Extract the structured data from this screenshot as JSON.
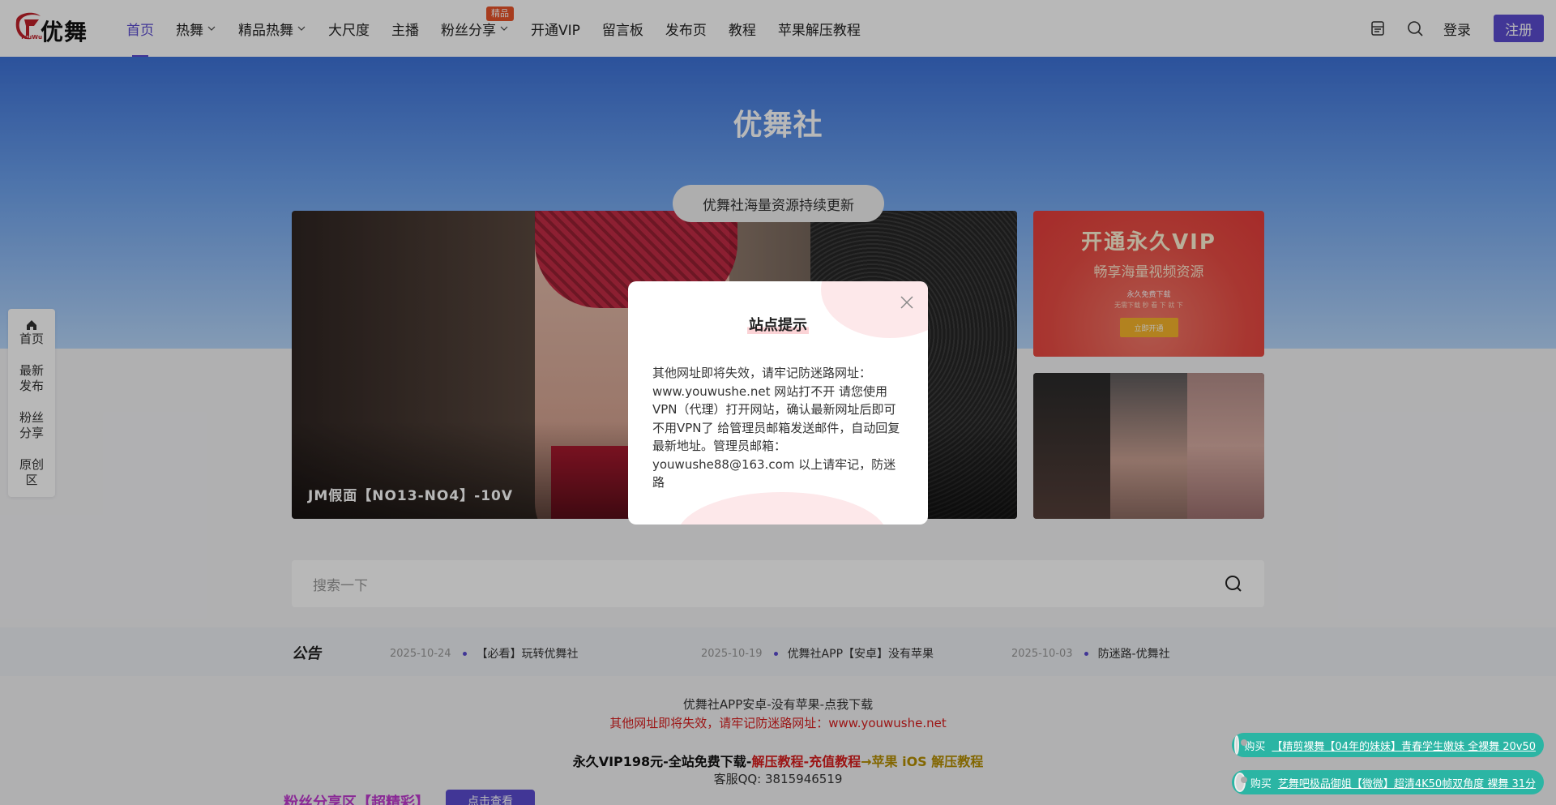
{
  "header": {
    "logo_text": "优舞",
    "logo_sub": "YouWu",
    "nav": [
      {
        "label": "首页",
        "active": true,
        "dropdown": false
      },
      {
        "label": "热舞",
        "dropdown": true
      },
      {
        "label": "精品热舞",
        "dropdown": true
      },
      {
        "label": "大尺度",
        "dropdown": false
      },
      {
        "label": "主播",
        "dropdown": false
      },
      {
        "label": "粉丝分享",
        "dropdown": true,
        "badge": "精品"
      },
      {
        "label": "开通VIP",
        "dropdown": false
      },
      {
        "label": "留言板",
        "dropdown": false
      },
      {
        "label": "发布页",
        "dropdown": false
      },
      {
        "label": "教程",
        "dropdown": false
      },
      {
        "label": "苹果解压教程",
        "dropdown": false
      }
    ],
    "login_label": "登录",
    "register_label": "注册",
    "icons": [
      "notebook-icon",
      "search-icon"
    ]
  },
  "hero": {
    "title": "优舞社",
    "pill": "优舞社海量资源持续更新"
  },
  "slider": {
    "caption": "JM假面【NO13-NO4】-10V"
  },
  "vip_card": {
    "title": "开通永久VIP",
    "subtitle": "畅享海量视频资源",
    "small1": "永久免费下载",
    "small2": "无需下载 秒 看 下 就 下",
    "button": "立即开通"
  },
  "search": {
    "placeholder": "搜索一下"
  },
  "notice": {
    "label": "公告",
    "items": [
      {
        "date": "2025-10-24",
        "text": "【必看】玩转优舞社"
      },
      {
        "date": "2025-10-19",
        "text": "优舞社APP【安卓】没有苹果"
      },
      {
        "date": "2025-10-03",
        "text": "防迷路-优舞社"
      }
    ]
  },
  "footer": {
    "line1": "优舞社APP安卓-没有苹果-点我下载",
    "line2": "其他网址即将失效，请牢记防迷路网址：www.youwushe.net",
    "line3_a": "永久VIP198元-全站免费下载-",
    "line3_b": "解压教程-充值教程",
    "line3_c": "→苹果 iOS 解压教程",
    "line4": "客服QQ: 3815946519",
    "fans_title": "粉丝分享区【超精彩】",
    "fans_button": "点击查看"
  },
  "float_menu": [
    {
      "label": "首页",
      "icon": "home-icon"
    },
    {
      "label": "最新发布"
    },
    {
      "label": "粉丝分享"
    },
    {
      "label": "原创区"
    }
  ],
  "toasts": [
    {
      "buy": "购买",
      "text": "【精剪裸舞【04年的妹妹】青春学生嫩妹 全裸舞 20v50"
    },
    {
      "buy": "购买",
      "text": "艺舞吧极品御姐【微微】超清4K50帧双角度 裸舞 31分"
    }
  ],
  "modal": {
    "title": "站点提示",
    "body": "其他网址即将失效，请牢记防迷路网址：www.youwushe.net 网站打不开 请您使用VPN（代理）打开网站，确认最新网址后即可不用VPN了 给管理员邮箱发送邮件，自动回复最新地址。管理员邮箱：youwushe88@163.com 以上请牢记，防迷路"
  }
}
